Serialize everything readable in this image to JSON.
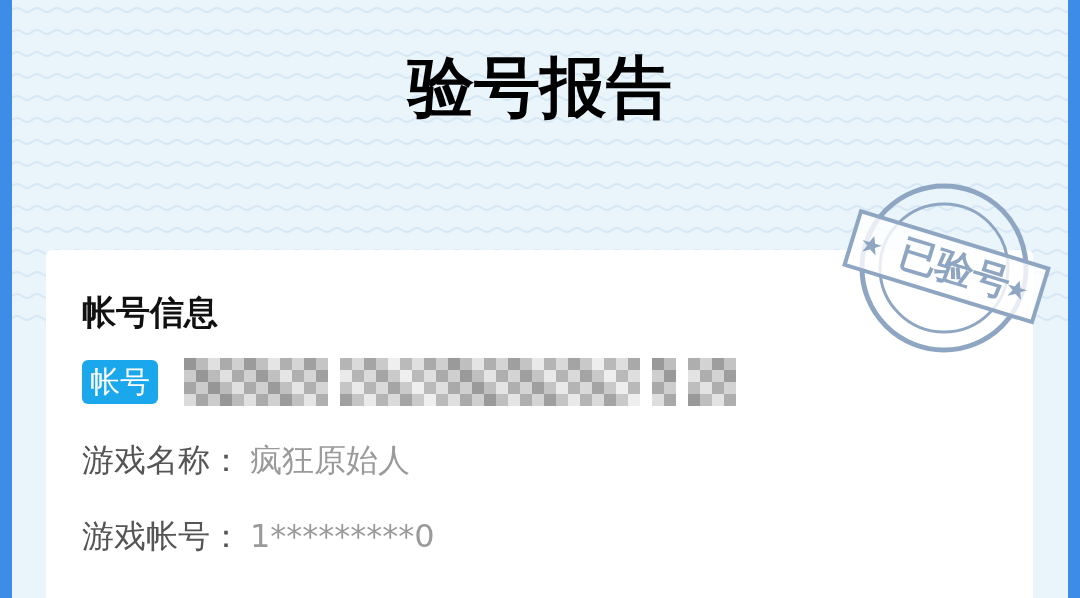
{
  "title": "验号报告",
  "stamp": {
    "text": "已验号"
  },
  "card": {
    "heading": "帐号信息",
    "account_badge": "帐号",
    "fields": [
      {
        "label": "游戏名称：",
        "value": "疯狂原始人"
      },
      {
        "label": "游戏帐号：",
        "value": "1*********0"
      }
    ]
  }
}
